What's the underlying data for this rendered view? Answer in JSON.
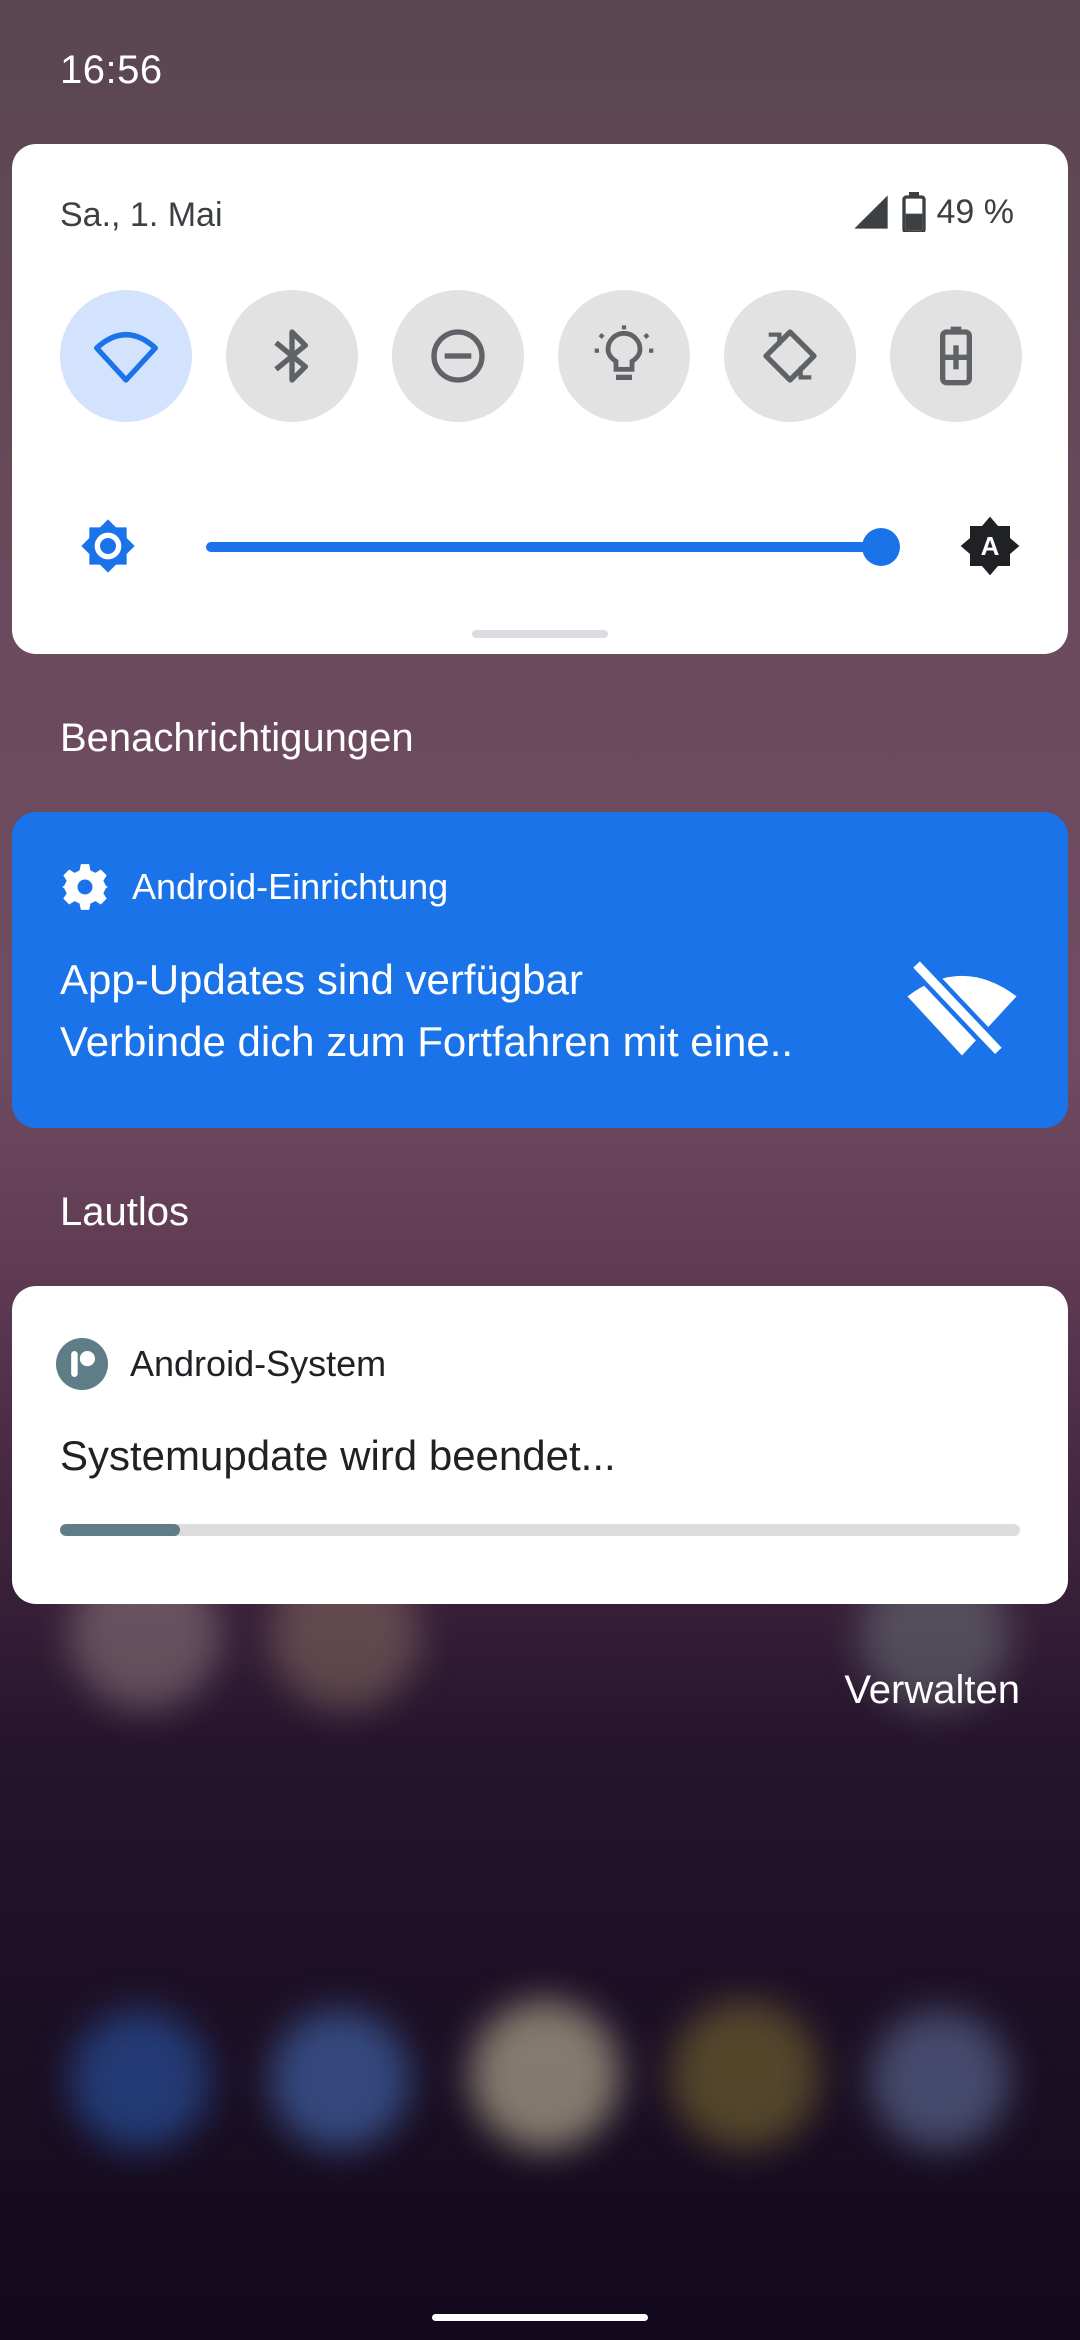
{
  "status_bar": {
    "time": "16:56"
  },
  "quick_settings": {
    "date": "Sa., 1. Mai",
    "battery_percent": "49 %",
    "tiles": [
      {
        "name": "wifi",
        "active": true
      },
      {
        "name": "bluetooth",
        "active": false
      },
      {
        "name": "do-not-disturb",
        "active": false
      },
      {
        "name": "flashlight",
        "active": false
      },
      {
        "name": "auto-rotate",
        "active": false
      },
      {
        "name": "battery-saver",
        "active": false
      }
    ],
    "brightness": {
      "level_fraction": 0.99,
      "auto_icon_label": "A"
    }
  },
  "sections": {
    "notifications_label": "Benachrichtigungen",
    "silent_label": "Lautlos"
  },
  "notifications": [
    {
      "app": "Android-Einrichtung",
      "title": "App-Updates sind verfügbar",
      "text": "Verbinde dich zum Fortfahren mit eine..",
      "background": "#1a73e8"
    },
    {
      "app": "Android-System",
      "title": "Systemupdate wird beendet...",
      "progress_fraction": 0.125
    }
  ],
  "manage_label": "Verwalten",
  "colors": {
    "accent": "#1a73e8",
    "progress": "#5f7d87"
  }
}
